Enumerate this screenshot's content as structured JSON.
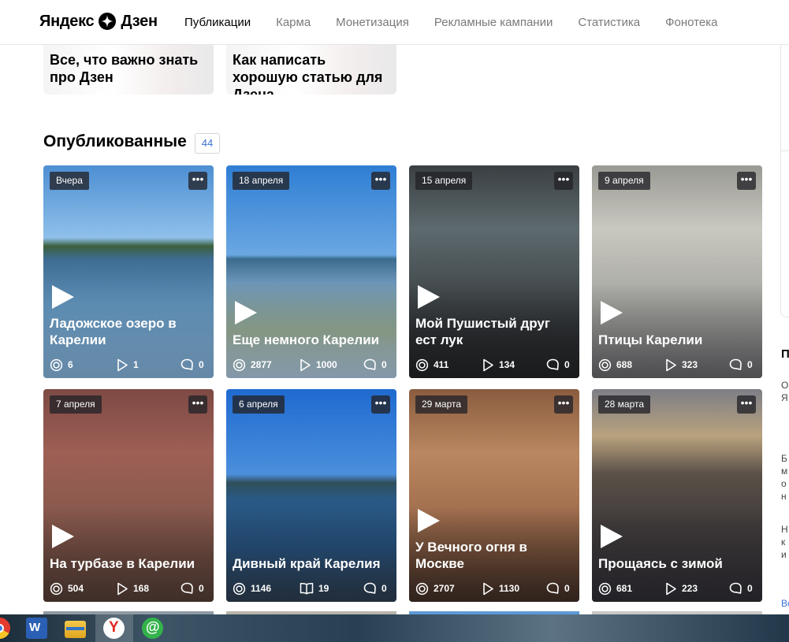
{
  "header": {
    "logo_text_left": "Яндекс",
    "logo_text_right": "Дзен",
    "nav": [
      "Публикации",
      "Карма",
      "Монетизация",
      "Рекламные кампании",
      "Статистика",
      "Фонотека"
    ]
  },
  "top_cards": [
    "Все, что важно знать про Дзен",
    "Как написать хорошую статью для Дзена"
  ],
  "section": {
    "title": "Опубликованные",
    "count": "44"
  },
  "cards": [
    {
      "date": "Вчера",
      "title": "Ладожское озеро в Карелии",
      "views": "6",
      "plays": "1",
      "comments": "0",
      "second_icon": "play"
    },
    {
      "date": "18 апреля",
      "title": "Еще немного Карелии",
      "views": "2877",
      "plays": "1000",
      "comments": "0",
      "second_icon": "play"
    },
    {
      "date": "15 апреля",
      "title": "Мой Пушистый друг ест лук",
      "views": "411",
      "plays": "134",
      "comments": "0",
      "second_icon": "play"
    },
    {
      "date": "9 апреля",
      "title": "Птицы Карелии",
      "views": "688",
      "plays": "323",
      "comments": "0",
      "second_icon": "play"
    },
    {
      "date": "7 апреля",
      "title": "На турбазе в Карелии",
      "views": "504",
      "plays": "168",
      "comments": "0",
      "second_icon": "play"
    },
    {
      "date": "6 апреля",
      "title": "Дивный край Карелия",
      "views": "1146",
      "plays": "19",
      "comments": "0",
      "second_icon": "book"
    },
    {
      "date": "29 марта",
      "title": "У Вечного огня в Москве",
      "views": "2707",
      "plays": "1130",
      "comments": "0",
      "second_icon": "play"
    },
    {
      "date": "28 марта",
      "title": "Прощаясь с зимой",
      "views": "681",
      "plays": "223",
      "comments": "0",
      "second_icon": "play"
    }
  ],
  "right_fragments": [
    "П",
    "О",
    "Я",
    "Б",
    "м",
    "о",
    "н",
    "Н",
    "к",
    "и",
    "Вс"
  ],
  "taskbar": [
    "chrome-icon",
    "word-icon",
    "explorer-icon",
    "yandex-browser-icon",
    "mail-ru-agent-icon"
  ]
}
